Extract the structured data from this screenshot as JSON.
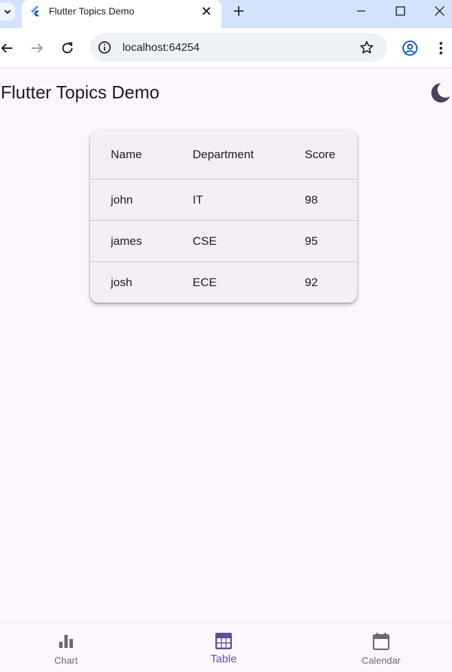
{
  "browser": {
    "tab_title": "Flutter Topics Demo",
    "url": "localhost:64254",
    "icons": {
      "tab_list": "chevron-down-icon",
      "favicon": "flutter-logo-icon",
      "tab_close": "close-icon",
      "new_tab": "plus-icon",
      "minimize": "minimize-icon",
      "maximize": "maximize-icon",
      "close_window": "close-icon",
      "back": "arrow-left-icon",
      "forward": "arrow-right-icon",
      "reload": "reload-icon",
      "site_info": "info-icon",
      "bookmark": "star-icon",
      "profile": "profile-icon",
      "menu": "kebab-menu-icon"
    }
  },
  "app": {
    "title": "Flutter Topics Demo",
    "theme_toggle_icon": "moon-icon",
    "colors": {
      "background": "#fdf7fd",
      "card": "#f4eff4",
      "accent": "#5d4e9e",
      "inactive": "#6b6870"
    }
  },
  "table": {
    "columns": [
      "Name",
      "Department",
      "Score"
    ],
    "rows": [
      [
        "john",
        "IT",
        "98"
      ],
      [
        "james",
        "CSE",
        "95"
      ],
      [
        "josh",
        "ECE",
        "92"
      ]
    ]
  },
  "bottom_nav": {
    "items": [
      {
        "label": "Chart",
        "icon": "bar-chart-icon",
        "active": false
      },
      {
        "label": "Table",
        "icon": "table-icon",
        "active": true
      },
      {
        "label": "Calendar",
        "icon": "calendar-icon",
        "active": false
      }
    ]
  }
}
